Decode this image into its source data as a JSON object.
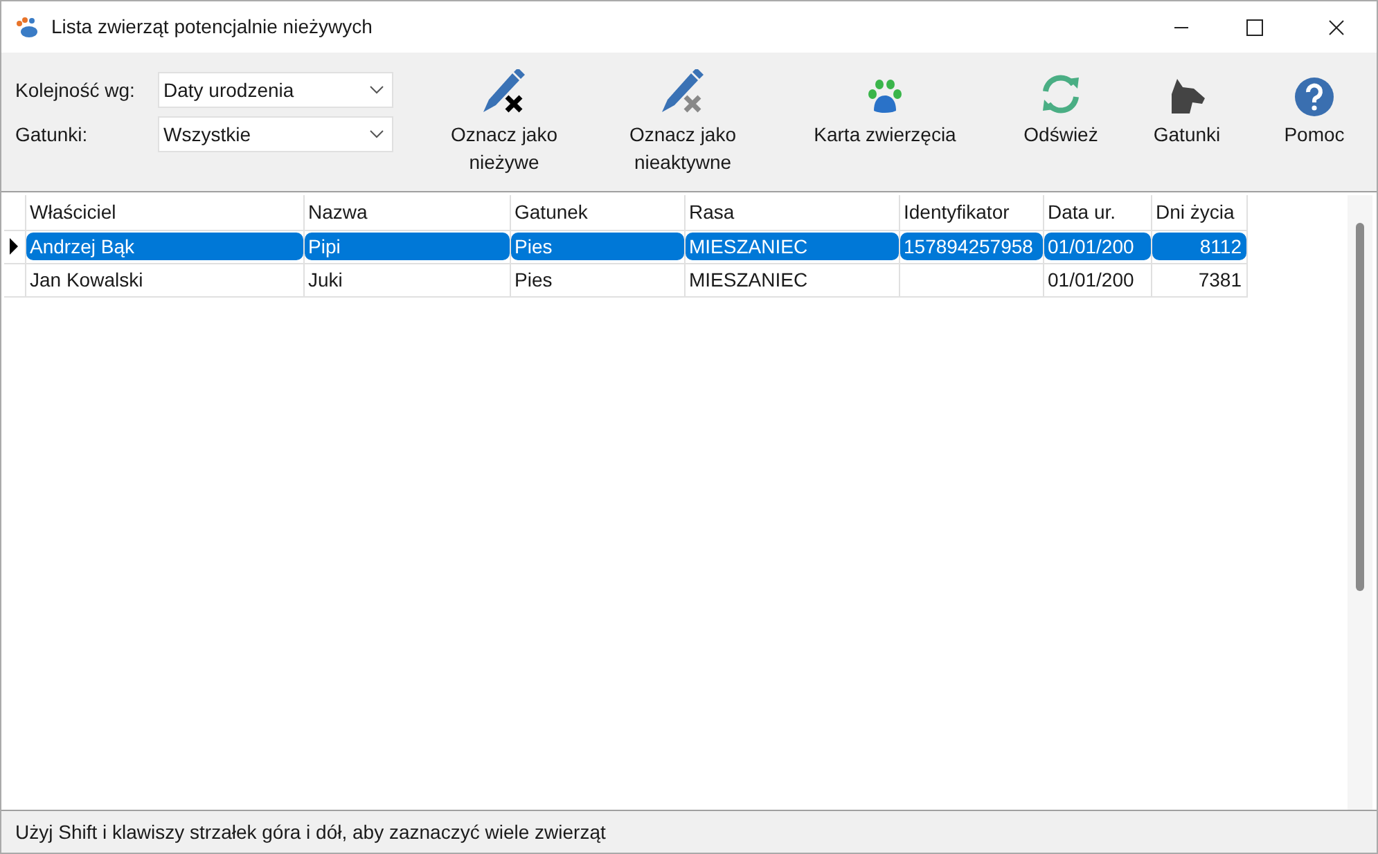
{
  "window": {
    "title": "Lista zwierząt potencjalnie nieżywych"
  },
  "filters": [
    {
      "label": "Kolejność wg:",
      "value": "Daty urodzenia"
    },
    {
      "label": "Gatunki:",
      "value": "Wszystkie"
    }
  ],
  "toolbar": [
    {
      "kind": "mark-dead",
      "label": "Oznacz jako nieżywe"
    },
    {
      "kind": "mark-inactive",
      "label": "Oznacz jako nieaktywne"
    },
    {
      "kind": "card",
      "label": "Karta zwierzęcia"
    },
    {
      "kind": "refresh",
      "label": "Odśwież"
    },
    {
      "kind": "species",
      "label": "Gatunki"
    },
    {
      "kind": "help",
      "label": "Pomoc"
    }
  ],
  "table": {
    "columns": [
      "Właściciel",
      "Nazwa",
      "Gatunek",
      "Rasa",
      "Identyfikator",
      "Data ur.",
      "Dni życia"
    ],
    "rows": [
      {
        "selected": true,
        "cells": [
          "Andrzej Bąk",
          "Pipi",
          "Pies",
          "MIESZANIEC",
          "157894257958",
          "01/01/200",
          "8112"
        ]
      },
      {
        "selected": false,
        "cells": [
          "Jan Kowalski",
          "Juki",
          "Pies",
          "MIESZANIEC",
          "",
          "01/01/200",
          "7381"
        ]
      }
    ]
  },
  "status_bar": "Użyj Shift i klawiszy strzałek góra i dół, aby zaznaczyć wiele zwierząt"
}
